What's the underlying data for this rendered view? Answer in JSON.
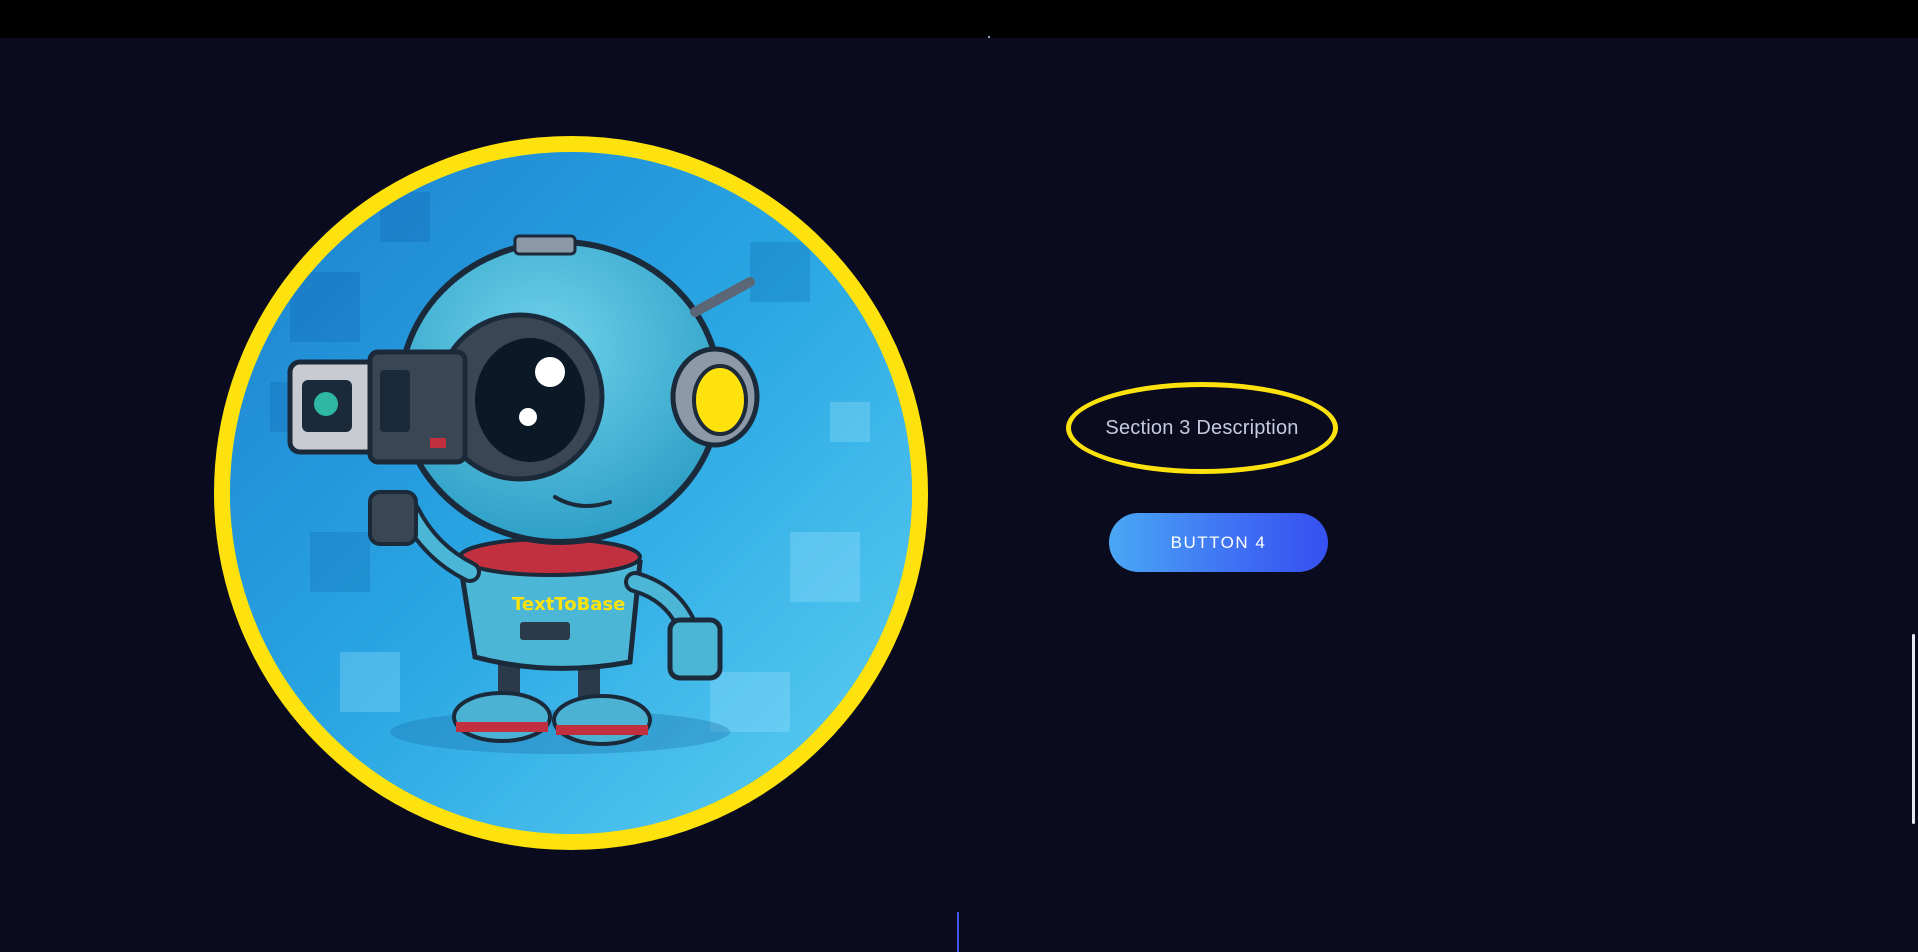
{
  "section": {
    "description": "Section 3 Description",
    "button_label": "BUTTON 4",
    "image_brand_text": "TextToBase"
  },
  "colors": {
    "background": "#0a0b1e",
    "topbar": "#000000",
    "highlight_yellow": "#fde20d",
    "button_gradient_start": "#4aa8f5",
    "button_gradient_end": "#3550ef",
    "accent_line": "#3d52e6"
  },
  "icons": {
    "hero": "robot-camera-mascot"
  }
}
